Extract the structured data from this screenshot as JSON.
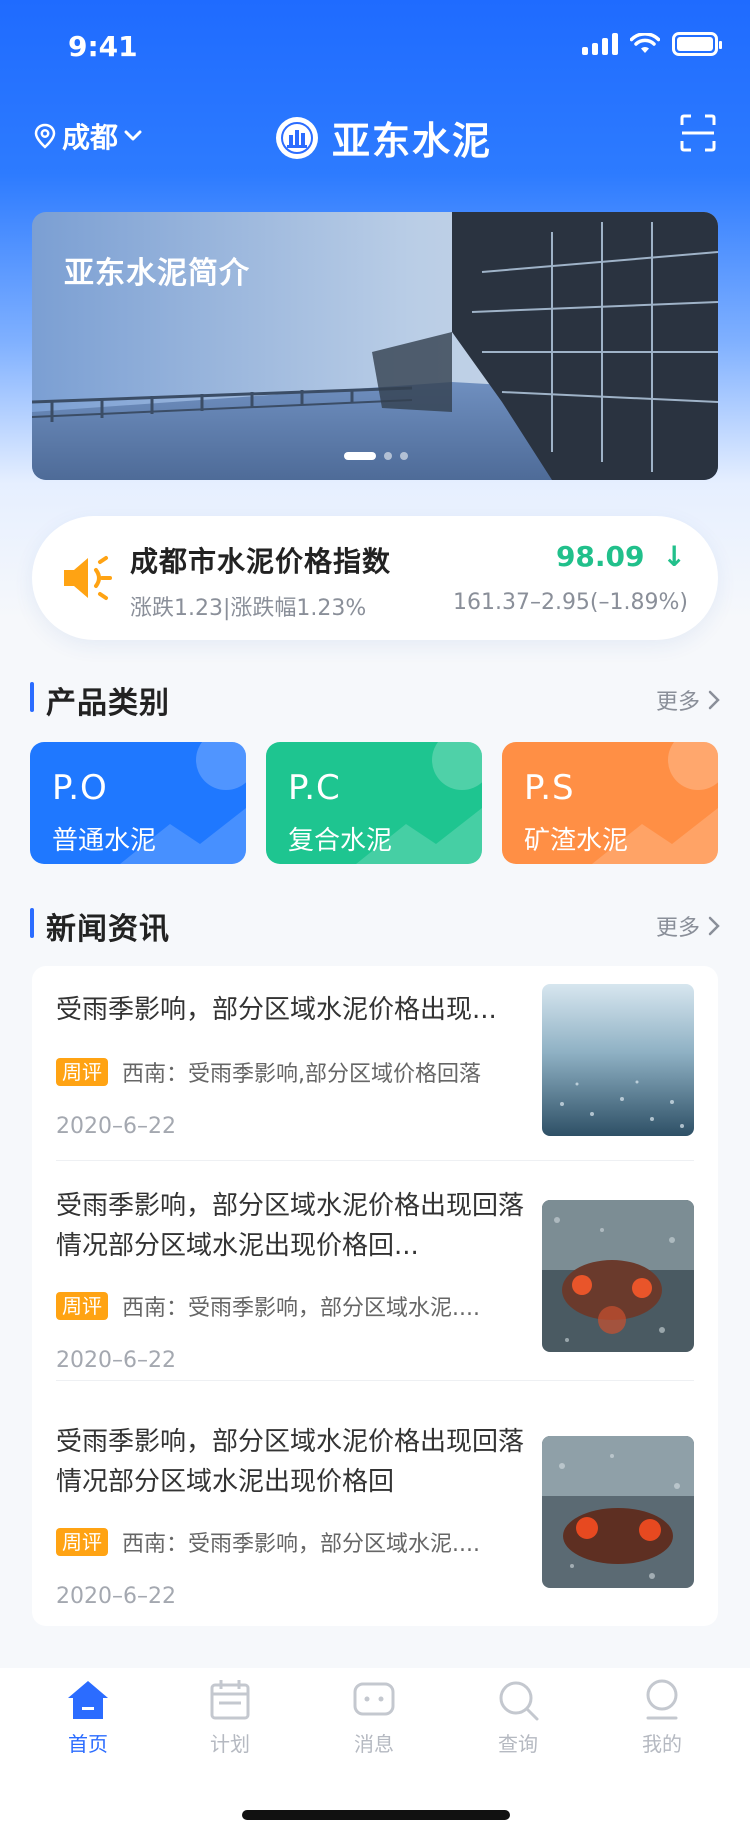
{
  "status_bar": {
    "time": "9:41"
  },
  "nav": {
    "city": "成都",
    "brand": "亚东水泥",
    "icons": [
      "location-icon",
      "chevron-down-icon",
      "brand-logo-icon",
      "scan-icon"
    ]
  },
  "banner": {
    "title": "亚东水泥简介",
    "slide_count": 3,
    "active_slide": 1
  },
  "price_index": {
    "title": "成都市水泥价格指数",
    "subtitle": "涨跌1.23|涨跌幅1.23%",
    "value": "98.09",
    "trend_arrow": "↓",
    "change": "161.37–2.95(–1.89%)",
    "value_color": "#21c08b"
  },
  "products": {
    "title": "产品类别",
    "more": "更多",
    "items": [
      {
        "code": "P.O",
        "name": "普通水泥",
        "color": "#1f78ff"
      },
      {
        "code": "P.C",
        "name": "复合水泥",
        "color": "#1ec590"
      },
      {
        "code": "P.S",
        "name": "矿渣水泥",
        "color": "#ff8f45"
      }
    ]
  },
  "news": {
    "title": "新闻资讯",
    "more": "更多",
    "items": [
      {
        "title": "受雨季影响，部分区域水泥价格出现...",
        "tag": "周评",
        "summary": "西南：受雨季影响,部分区域价格回落",
        "date": "2020–6–22"
      },
      {
        "title": "受雨季影响，部分区域水泥价格出现回落情况部分区域水泥出现价格回...",
        "tag": "周评",
        "summary": "西南：受雨季影响，部分区域水泥....",
        "date": "2020–6–22"
      },
      {
        "title": "受雨季影响，部分区域水泥价格出现回落情况部分区域水泥出现价格回",
        "tag": "周评",
        "summary": "西南：受雨季影响，部分区域水泥....",
        "date": "2020–6–22"
      }
    ]
  },
  "tabbar": {
    "accent": "#2b6cff",
    "items": [
      {
        "label": "首页",
        "icon": "home-icon",
        "active": true
      },
      {
        "label": "计划",
        "icon": "calendar-icon",
        "active": false
      },
      {
        "label": "消息",
        "icon": "message-icon",
        "active": false
      },
      {
        "label": "查询",
        "icon": "search-icon",
        "active": false
      },
      {
        "label": "我的",
        "icon": "user-icon",
        "active": false
      }
    ]
  }
}
